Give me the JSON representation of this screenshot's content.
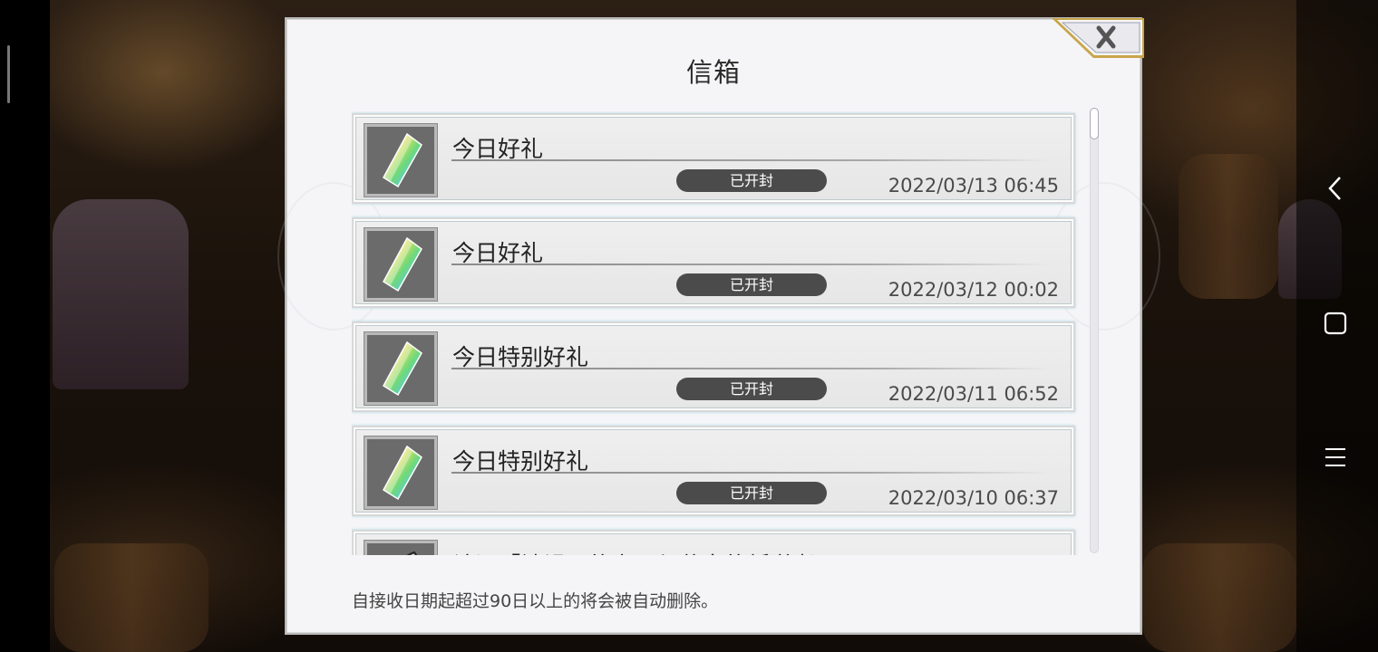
{
  "dialog": {
    "title": "信箱",
    "close_icon": "close-x-icon",
    "footer_note": "自接收日期起超过90日以上的将会被自动删除。"
  },
  "mails": [
    {
      "title": "今日好礼",
      "status": "已开封",
      "date": "2022/03/13 06:45",
      "icon": "rainbow-crystal-icon"
    },
    {
      "title": "今日好礼",
      "status": "已开封",
      "date": "2022/03/12 00:02",
      "icon": "rainbow-crystal-icon"
    },
    {
      "title": "今日特别好礼",
      "status": "已开封",
      "date": "2022/03/11 06:52",
      "icon": "rainbow-crystal-icon"
    },
    {
      "title": "今日特别好礼",
      "status": "已开封",
      "date": "2022/03/10 06:37",
      "icon": "rainbow-crystal-icon"
    },
    {
      "title": "认证「被诅咒的帝国与荣富的叛逆者",
      "status": "",
      "date": "",
      "icon": "feather-icon"
    }
  ],
  "system_nav": {
    "back_icon": "back-chevron-icon",
    "home_icon": "square-home-icon",
    "menu_icon": "menu-lines-icon"
  }
}
